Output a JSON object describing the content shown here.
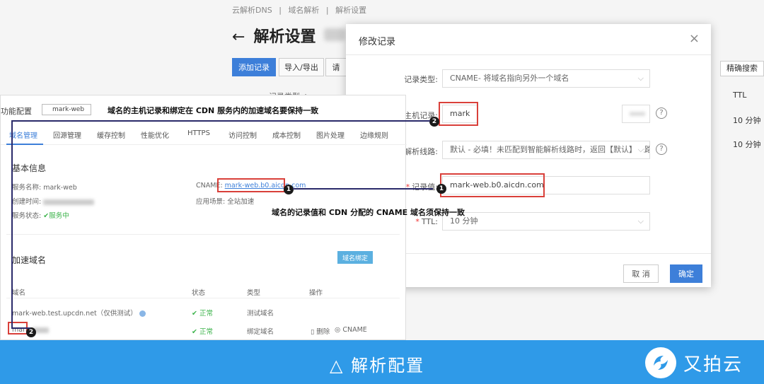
{
  "background": {
    "breadcrumbs": [
      "云解析DNS",
      "|",
      "域名解析",
      "|",
      "解析设置"
    ],
    "page_title": "解析设置",
    "back_arrow": "←",
    "add_record": "添加记录",
    "import_export": "导入/导出",
    "third_btn": "请",
    "search_label": "精确搜索",
    "col_record_type": "记录类型 ≑",
    "col_ttl": "TTL",
    "ttl_row1": "10 分钟",
    "ttl_row2": "10 分钟"
  },
  "modal": {
    "title": "修改记录",
    "close": "×",
    "fields": {
      "record_type": {
        "label": "记录类型:",
        "value": "CNAME- 将域名指向另外一个域名"
      },
      "host": {
        "label": "主机记录:",
        "value": "mark"
      },
      "line": {
        "label": "解析线路:",
        "value": "默认 - 必填！未匹配到智能解析线路时，返回【默认】线路..."
      },
      "record_value": {
        "label": "记录值:",
        "value": "mark-web.b0.aicdn.com"
      },
      "ttl": {
        "label": "TTL:",
        "value": "10 分钟"
      }
    },
    "required_mark": "*",
    "help": "?",
    "cancel": "取 消",
    "confirm": "确定"
  },
  "cdn_panel": {
    "config_label": "功能配置",
    "config_select": "mark-web",
    "tabs": [
      "域名管理",
      "回源管理",
      "缓存控制",
      "性能优化",
      "HTTPS",
      "访问控制",
      "成本控制",
      "图片处理",
      "边缘规则"
    ],
    "basic_info": "基本信息",
    "service_name_label": "服务名称: ",
    "service_name": "mark-web",
    "created_label": "创建时间:",
    "status_label": "服务状态:",
    "status_value": "服务中",
    "cname_label": "CNAME: ",
    "cname_value": "mark-web.b0.aicdn.com",
    "scenario_label": "应用场景: ",
    "scenario_value": "全站加速",
    "accel_domain": "加速域名",
    "bind_btn": "域名绑定",
    "table_headers": [
      "域名",
      "状态",
      "类型",
      "操作"
    ],
    "rows": [
      {
        "domain": "mark-web.test.upcdn.net（仅供测试）",
        "status": "正常",
        "type": "测试域名",
        "op": ""
      },
      {
        "domain": "mark",
        "status": "正常",
        "type": "绑定域名",
        "op_delete": "删除",
        "op_cname": "CNAME"
      }
    ]
  },
  "annotations": {
    "top_note": "域名的主机记录和绑定在 CDN 服务内的加速域名要保持一致",
    "mid_note": "域名的记录值和 CDN 分配的 CNAME 域名须保持一致",
    "badge1": "1",
    "badge2": "2"
  },
  "footer": {
    "title": "△ 解析配置",
    "brand": "又拍云"
  },
  "colors": {
    "primary": "#3d7fd9",
    "footer": "#2f9ae8",
    "highlight": "#d9403a",
    "ok": "#3bb34a"
  }
}
